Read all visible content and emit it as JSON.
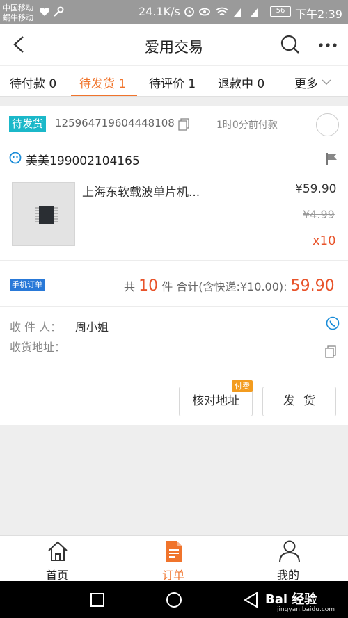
{
  "status_bar": {
    "carrier_1": "中国移动",
    "carrier_2": "蜗牛移动",
    "net_speed": "24.1K/s",
    "battery": "56",
    "time": "下午2:39"
  },
  "nav": {
    "title": "爱用交易"
  },
  "tabs": [
    {
      "label": "待付款 0"
    },
    {
      "label": "待发货 1"
    },
    {
      "label": "待评价 1"
    },
    {
      "label": "退款中 0"
    },
    {
      "label": "更多"
    }
  ],
  "order": {
    "status": "待发货",
    "order_no": "125964719604448108",
    "paid_time": "1时0分前付款",
    "buyer": "美美199002104165",
    "item": {
      "title": "上海东软载波单片机...",
      "price": "¥59.90",
      "original_price": "¥4.99",
      "quantity": "x10"
    },
    "mobile_tag": "手机订单",
    "summary": {
      "prefix": "共",
      "count": "10",
      "suffix": "件 合计(含快递:¥10.00):",
      "total": "59.90"
    },
    "receiver_label": "收 件 人：",
    "receiver_name": "周小姐",
    "address_label": "收货地址："
  },
  "actions": {
    "verify_address": "核对地址",
    "paid_flag": "付费",
    "ship": "发货"
  },
  "bottom_tabs": [
    {
      "label": "首页"
    },
    {
      "label": "订单"
    },
    {
      "label": "我的"
    }
  ],
  "watermark": {
    "brand": "Bai 经验",
    "url": "jingyan.baidu.com"
  },
  "colors": {
    "accent": "#f0742c",
    "price_red": "#e8532a",
    "status_teal": "#1bb8c9",
    "mobile_blue": "#2979d8"
  }
}
